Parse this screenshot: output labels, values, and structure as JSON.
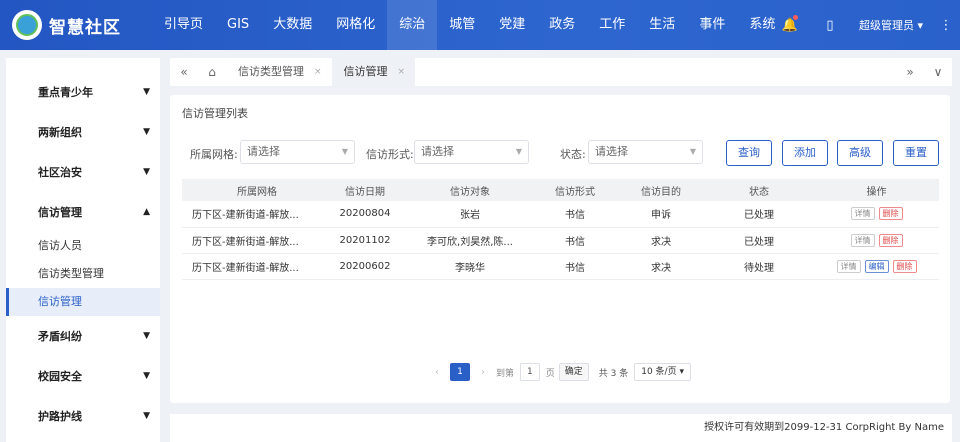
{
  "app": {
    "title": "智慧社区"
  },
  "nav": [
    "引导页",
    "GIS",
    "大数据",
    "网格化",
    "综治",
    "城管",
    "党建",
    "政务",
    "工作",
    "生活",
    "事件",
    "系统"
  ],
  "nav_active": "综治",
  "header_right": {
    "user": "超级管理员 ▾",
    "bell": "🔔",
    "phone": "▯",
    "more": "⋮"
  },
  "sidebar": {
    "groups": [
      {
        "label": "重点青少年",
        "caret": "▼"
      },
      {
        "label": "两新组织",
        "caret": "▼"
      },
      {
        "label": "社区治安",
        "caret": "▼"
      },
      {
        "label": "信访管理",
        "caret": "▲"
      }
    ],
    "subs": [
      "信访人员",
      "信访类型管理",
      "信访管理"
    ],
    "groups_after": [
      {
        "label": "矛盾纠纷",
        "caret": "▼"
      },
      {
        "label": "校园安全",
        "caret": "▼"
      },
      {
        "label": "护路护线",
        "caret": "▼"
      }
    ]
  },
  "tabs": [
    {
      "label": "信访类型管理",
      "close": "×"
    },
    {
      "label": "信访管理",
      "close": "×"
    }
  ],
  "tabbar_icons": {
    "prev": "«",
    "home": "⌂",
    "next": "»",
    "down": "∨"
  },
  "panel": {
    "title": "信访管理列表",
    "filters": [
      {
        "label": "所属网格:",
        "placeholder": "请选择"
      },
      {
        "label": "信访形式:",
        "placeholder": "请选择"
      },
      {
        "label": "状态:",
        "placeholder": "请选择"
      }
    ],
    "buttons": [
      "查询",
      "添加",
      "高级",
      "重置"
    ]
  },
  "table": {
    "headers": [
      "所属网格",
      "信访日期",
      "信访对象",
      "信访形式",
      "信访目的",
      "状态",
      "操作"
    ],
    "rows": [
      {
        "grid": "历下区-建新街道-解放...",
        "date": "20200804",
        "target": "张岩",
        "form": "书信",
        "purpose": "申诉",
        "status": "已处理",
        "ops": [
          "详情",
          "删除"
        ]
      },
      {
        "grid": "历下区-建新街道-解放...",
        "date": "20201102",
        "target": "李可欣,刘昊然,陈...",
        "form": "书信",
        "purpose": "求决",
        "status": "已处理",
        "ops": [
          "详情",
          "删除"
        ]
      },
      {
        "grid": "历下区-建新街道-解放...",
        "date": "20200602",
        "target": "李晓华",
        "form": "书信",
        "purpose": "求决",
        "status": "待处理",
        "ops": [
          "详情",
          "编辑",
          "删除"
        ]
      }
    ]
  },
  "pager": {
    "page": "1",
    "goto_label": "到第",
    "goto_value": "1",
    "page_unit": "页",
    "confirm": "确定",
    "total": "共 3 条",
    "size": "10 条/页 ▾"
  },
  "footer": "授权许可有效期到2099-12-31 CorpRight By Name"
}
